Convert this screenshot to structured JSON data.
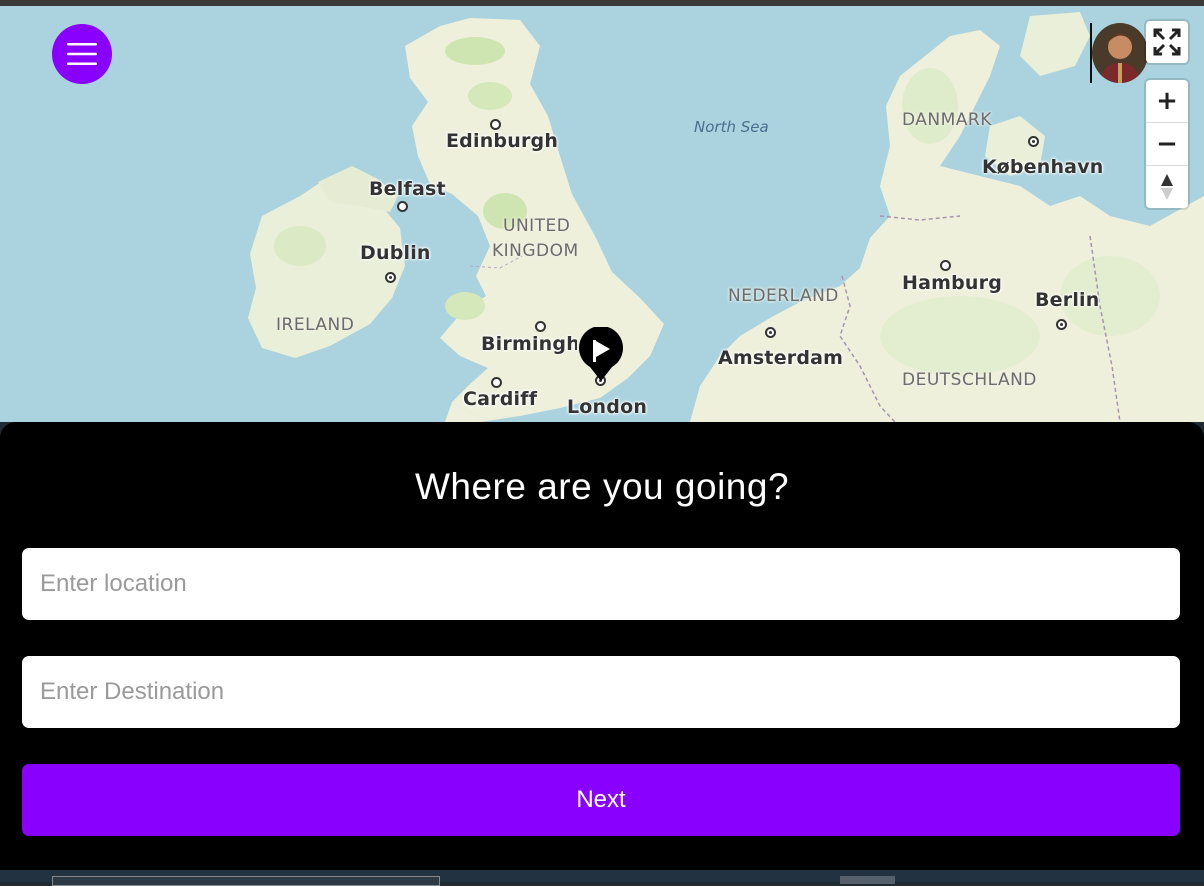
{
  "map": {
    "cities": [
      "Edinburgh",
      "Belfast",
      "Dublin",
      "Birmingham",
      "Cardiff",
      "London",
      "Amsterdam",
      "Hamburg",
      "Berlin",
      "København"
    ],
    "countries": [
      "UNITED",
      "KINGDOM",
      "IRELAND",
      "NEDERLAND",
      "DEUTSCHLAND",
      "DANMARK"
    ],
    "seas": [
      "North Sea"
    ],
    "controls": {
      "fullscreen_icon": "fullscreen-icon",
      "zoom_in": "+",
      "zoom_out": "−",
      "compass_icon": "compass-icon"
    },
    "marker_icon": "flag-marker-icon",
    "colors": {
      "water": "#aad3df",
      "land": "#f2efe9",
      "green": "#cfe5b1"
    }
  },
  "header": {
    "menu_icon": "hamburger-menu-icon",
    "avatar": "user-avatar"
  },
  "panel": {
    "title": "Where are you going?",
    "location_placeholder": "Enter location",
    "destination_placeholder": "Enter Destination",
    "next_label": "Next",
    "accent": "#8a00ff"
  }
}
